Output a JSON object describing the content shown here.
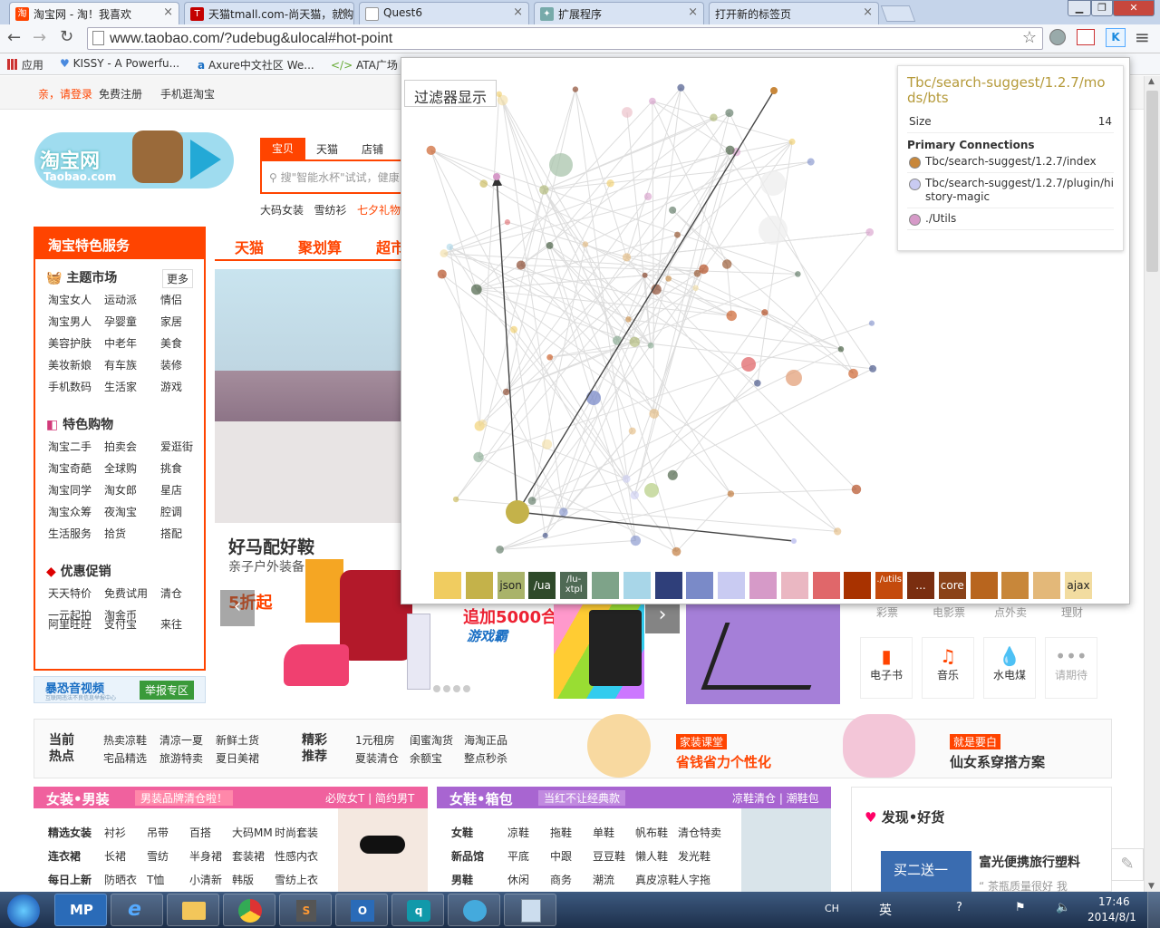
{
  "browser": {
    "tabs": [
      {
        "title": "淘宝网 - 淘！我喜欢",
        "icon": "taobao-favicon",
        "color": "#f40"
      },
      {
        "title": "天猫tmall.com-尚天猫，就购了",
        "icon": "tmall-favicon",
        "color": "#c40000"
      },
      {
        "title": "Quest6",
        "icon": "page-icon",
        "color": "#888"
      },
      {
        "title": "扩展程序",
        "icon": "puzzle-icon",
        "color": "#6a8"
      },
      {
        "title": "打开新的标签页",
        "icon": "",
        "color": ""
      }
    ],
    "url": "www.taobao.com/?udebug&ulocal#hot-point",
    "bookmarks": [
      "应用",
      "KISSY - A Powerfu...",
      "Axure中文社区 We...",
      "ATA广场"
    ]
  },
  "site": {
    "login": "亲，请登录",
    "register": "免费注册",
    "mobile": "手机逛淘宝",
    "logo_text": "淘宝网",
    "logo_sub": "Taobao.com",
    "search_tabs": [
      "宝贝",
      "天猫",
      "店铺"
    ],
    "search_placeholder": "搜\"智能水杯\"试试，健康",
    "hot_words": [
      "大码女装",
      "雪纺衫",
      "七夕礼物"
    ],
    "services_title": "淘宝特色服务",
    "theme_market": "主题市场",
    "more": "更多",
    "theme_links": [
      "淘宝女人",
      "运动派",
      "情侣",
      "淘宝男人",
      "孕婴童",
      "家居",
      "美容护肤",
      "中老年",
      "美食",
      "美妆新娘",
      "有车族",
      "装修",
      "手机数码",
      "生活家",
      "游戏"
    ],
    "special_title": "特色购物",
    "special_links": [
      "淘宝二手",
      "拍卖会",
      "爱逛街",
      "淘宝奇葩",
      "全球购",
      "挑食",
      "淘宝同学",
      "淘女郎",
      "星店",
      "淘宝众筹",
      "夜淘宝",
      "腔调",
      "生活服务",
      "拾货",
      "搭配"
    ],
    "promo_title": "优惠促销",
    "promo_links": [
      "天天特价",
      "免费试用",
      "清仓",
      "一元起拍",
      "淘金币",
      "",
      "阿里旺旺",
      "支付宝",
      "来往"
    ],
    "banner_ad": "暴恐音视频",
    "banner_ad_sub": "互联网违法不良信息举报中心",
    "report_btn": "举报专区",
    "nav": [
      "天猫",
      "聚划算",
      "超市"
    ],
    "promo_headline": "好马配好鞍",
    "promo_sub": "亲子户外装备",
    "promo_price": "5折起",
    "game_text": "追加5000合",
    "game_sub": "游戏霸",
    "quick_top": [
      "彩票",
      "电影票",
      "点外卖",
      "理财"
    ],
    "quick": [
      {
        "label": "电子书",
        "icon": "ebook-icon"
      },
      {
        "label": "音乐",
        "icon": "music-icon"
      },
      {
        "label": "水电煤",
        "icon": "utility-drop-icon"
      },
      {
        "label": "请期待",
        "icon": "more-dots-icon"
      }
    ],
    "hot_label": [
      "当前",
      "热点"
    ],
    "hot_links": [
      "热卖凉鞋",
      "清凉一夏",
      "新鲜土货",
      "宅品精选",
      "旅游特卖",
      "夏日美裙"
    ],
    "rec_label": [
      "精彩",
      "推荐"
    ],
    "rec_links": [
      "1元租房",
      "闺蜜淘货",
      "海淘正品",
      "夏装清仓",
      "余额宝",
      "整点秒杀"
    ],
    "class_tag": "家装课堂",
    "class_text": "省钱省力个性化",
    "beauty_tag": "就是要白",
    "beauty_text": "仙女系穿搭方案",
    "cat1_title": "女装•男装",
    "cat1_tag": "男装品牌清仓啦！",
    "cat1_right": "必败女T | 简约男T",
    "cat1_rows": [
      [
        "精选女装",
        "衬衫",
        "吊带",
        "百搭",
        "大码MM",
        "时尚套装"
      ],
      [
        "连衣裙",
        "长裙",
        "雪纺",
        "半身裙",
        "套装裙",
        "性感内衣"
      ],
      [
        "每日上新",
        "防晒衣",
        "T恤",
        "小清新",
        "韩版",
        "雪纺上衣"
      ]
    ],
    "cat2_title": "女鞋•箱包",
    "cat2_tag": "当红不让经典款",
    "cat2_right": "凉鞋清仓 | 潮鞋包",
    "cat2_rows": [
      [
        "女鞋",
        "凉鞋",
        "拖鞋",
        "单鞋",
        "帆布鞋",
        "清仓特卖"
      ],
      [
        "新品馆",
        "平底",
        "中跟",
        "豆豆鞋",
        "懒人鞋",
        "发光鞋"
      ],
      [
        "男鞋",
        "休闲",
        "商务",
        "潮流",
        "真皮凉鞋",
        "人字拖"
      ]
    ],
    "discover_title": "发现•好货",
    "discover_item": "富光便携旅行塑料",
    "discover_quote": "茶瓶质量很好 我",
    "discover_img_text": "买二送一"
  },
  "overlay": {
    "filter_label": "过滤器显示",
    "info": {
      "title": "Tbc/search-suggest/1.2.7/mods/bts",
      "size_label": "Size",
      "size_value": "14",
      "connections_label": "Primary Connections",
      "connections": [
        {
          "name": "Tbc/search-suggest/1.2.7/index",
          "color": "#c8873a"
        },
        {
          "name": "Tbc/search-suggest/1.2.7/plugin/history-magic",
          "color": "#c9cbf2"
        },
        {
          "name": "./Utils",
          "color": "#d69ac8"
        }
      ]
    },
    "legend": [
      {
        "label": "",
        "color": "#f0cc60"
      },
      {
        "label": "",
        "color": "#c4b24a"
      },
      {
        "label": "json",
        "color": "#a9b36a"
      },
      {
        "label": "/ua",
        "color": "#2f4a2a"
      },
      {
        "label": "/lu-xtpl",
        "color": "#4f6a55"
      },
      {
        "label": "",
        "color": "#7ea389"
      },
      {
        "label": "",
        "color": "#a8d6e8"
      },
      {
        "label": "",
        "color": "#2f3f7a"
      },
      {
        "label": "",
        "color": "#7a8ac8"
      },
      {
        "label": "",
        "color": "#c9cbf2"
      },
      {
        "label": "",
        "color": "#d69ac8"
      },
      {
        "label": "",
        "color": "#eab7c2"
      },
      {
        "label": "",
        "color": "#e0676a"
      },
      {
        "label": "",
        "color": "#a83200"
      },
      {
        "label": "./utils",
        "color": "#c44a0c"
      },
      {
        "label": "...",
        "color": "#7a2e10"
      },
      {
        "label": "core",
        "color": "#8a4218"
      },
      {
        "label": "",
        "color": "#b8651e"
      },
      {
        "label": "",
        "color": "#c8873a"
      },
      {
        "label": "",
        "color": "#e3b879"
      },
      {
        "label": "ajax",
        "color": "#f2dca0"
      }
    ]
  },
  "taskbar": {
    "apps": [
      "MP",
      "e",
      "folder",
      "chrome",
      "S",
      "outlook",
      "qq",
      "bubble",
      "calc"
    ],
    "lang": "CH",
    "ime": "英",
    "time": "17:46",
    "date": "2014/8/1"
  }
}
